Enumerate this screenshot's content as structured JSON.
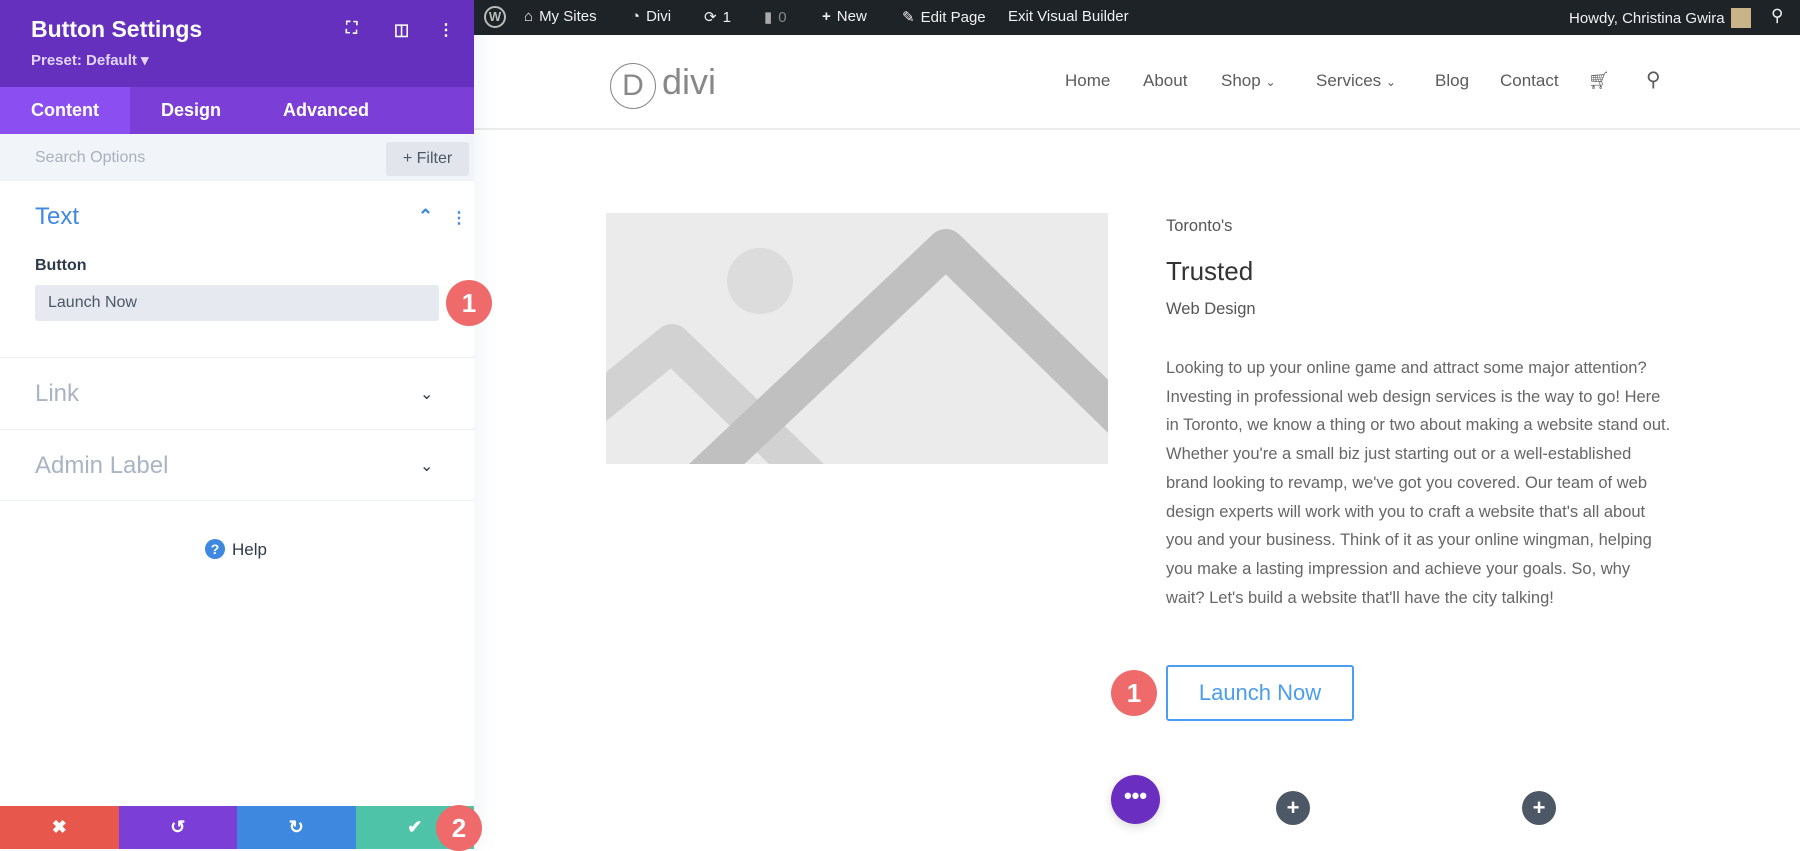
{
  "panel": {
    "title": "Button Settings",
    "preset": "Preset: Default ▾",
    "tabs": [
      "Content",
      "Design",
      "Advanced"
    ],
    "search_placeholder": "Search Options",
    "filter": "+ Filter",
    "sections": {
      "text": "Text",
      "button_label": "Button",
      "button_value": "Launch Now",
      "link": "Link",
      "admin_label": "Admin Label"
    },
    "help": "Help",
    "colors": {
      "cancel": "#e8574b",
      "undo": "#7b3fd7",
      "redo": "#3e88e0",
      "save": "#4fc3a7"
    }
  },
  "badges": {
    "one": "1",
    "two": "2"
  },
  "adminbar": {
    "my_sites": "My Sites",
    "site": "Divi",
    "updates": "1",
    "comments": "0",
    "new": "New",
    "edit": "Edit Page",
    "exit": "Exit Visual Builder",
    "howdy": "Howdy, Christina Gwira"
  },
  "site": {
    "logo_letter": "D",
    "logo": "divi",
    "nav": [
      "Home",
      "About",
      "Shop",
      "Services",
      "Blog",
      "Contact"
    ]
  },
  "content": {
    "kicker": "Toronto's",
    "heading": "Trusted",
    "sub": "Web Design",
    "paragraph": "Looking to up your online game and attract some major attention? Investing in professional web design services is the way to go! Here in Toronto, we know a thing or two about making a website stand out. Whether you're a small biz just starting out or a well-established brand looking to revamp, we've got you covered. Our team of web design experts will work with you to craft a website that's all about you and your business. Think of it as your online wingman, helping you make a lasting impression and achieve your goals. So, why wait? Let's build a website that'll have the city talking!",
    "button": "Launch Now"
  }
}
